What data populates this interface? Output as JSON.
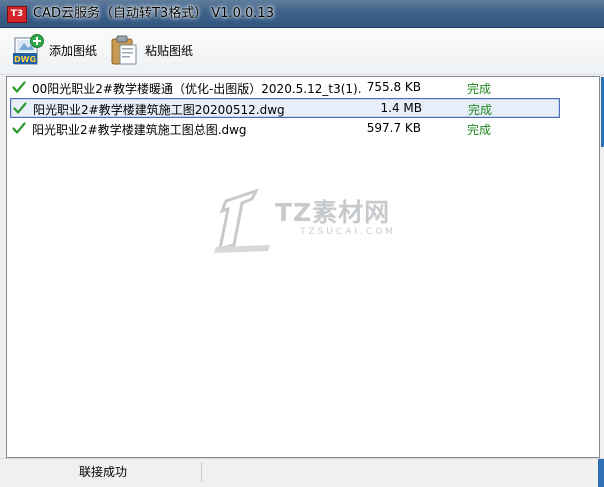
{
  "window": {
    "title": "CAD云服务（自动转T3格式） V1.0.0.13",
    "icon": {
      "name": "app-icon",
      "text": "T3",
      "color": "#d6242b"
    }
  },
  "toolbar": {
    "add_label": "添加图纸",
    "add_icon": "dwg-add-icon",
    "paste_label": "粘贴图纸",
    "paste_icon": "clipboard-paste-icon"
  },
  "files": [
    {
      "name": "00阳光职业2#教学楼暖通（优化-出图版）2020.5.12_t3(1)...",
      "size": "755.8 KB",
      "status": "完成",
      "icon": "check-icon",
      "selected": false
    },
    {
      "name": "阳光职业2#教学楼建筑施工图20200512.dwg",
      "size": "1.4 MB",
      "status": "完成",
      "icon": "check-icon",
      "selected": true
    },
    {
      "name": "阳光职业2#教学楼建筑施工图总图.dwg",
      "size": "597.7 KB",
      "status": "完成",
      "icon": "check-icon",
      "selected": false
    }
  ],
  "watermark": {
    "title": "TZ素材网",
    "subtitle": "TZSUCAI.COM"
  },
  "statusbar": {
    "connection": "联接成功"
  },
  "colors": {
    "accent": "#2f6fb3",
    "status_done": "#1f8a1f",
    "check": "#2e9b2e",
    "selection_border": "#4d6bb2"
  }
}
